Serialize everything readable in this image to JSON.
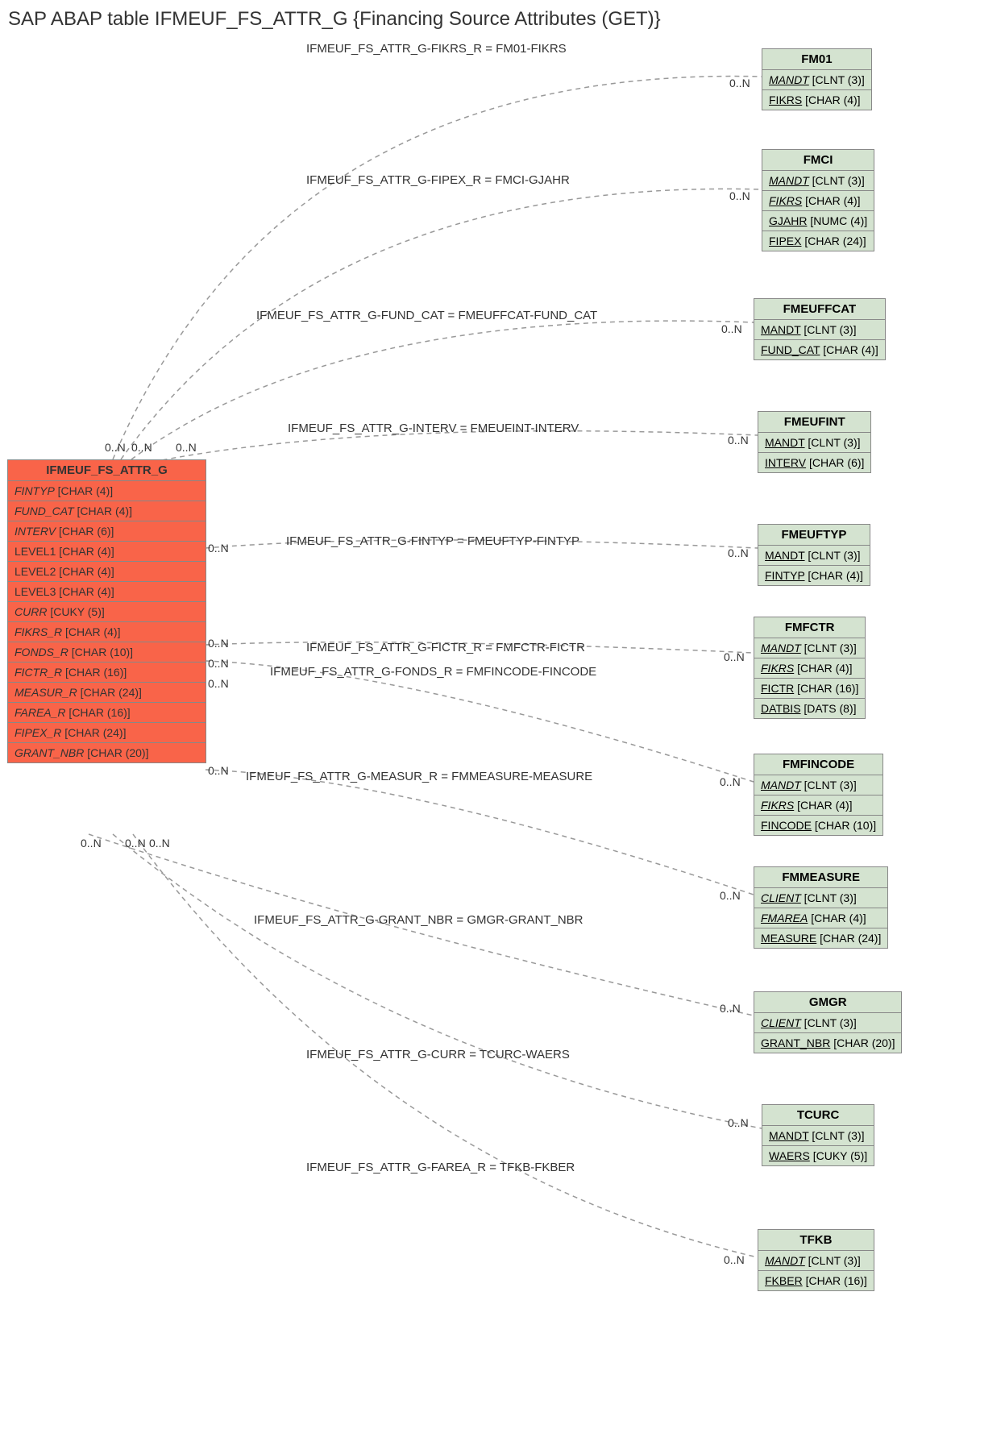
{
  "title": "SAP ABAP table IFMEUF_FS_ATTR_G {Financing Source Attributes (GET)}",
  "main": {
    "name": "IFMEUF_FS_ATTR_G",
    "fields": [
      {
        "name": "FINTYP",
        "type": "[CHAR (4)]",
        "italic": true
      },
      {
        "name": "FUND_CAT",
        "type": "[CHAR (4)]",
        "italic": true
      },
      {
        "name": "INTERV",
        "type": "[CHAR (6)]",
        "italic": true
      },
      {
        "name": "LEVEL1",
        "type": "[CHAR (4)]",
        "italic": false
      },
      {
        "name": "LEVEL2",
        "type": "[CHAR (4)]",
        "italic": false
      },
      {
        "name": "LEVEL3",
        "type": "[CHAR (4)]",
        "italic": false
      },
      {
        "name": "CURR",
        "type": "[CUKY (5)]",
        "italic": true
      },
      {
        "name": "FIKRS_R",
        "type": "[CHAR (4)]",
        "italic": true
      },
      {
        "name": "FONDS_R",
        "type": "[CHAR (10)]",
        "italic": true
      },
      {
        "name": "FICTR_R",
        "type": "[CHAR (16)]",
        "italic": true
      },
      {
        "name": "MEASUR_R",
        "type": "[CHAR (24)]",
        "italic": true
      },
      {
        "name": "FAREA_R",
        "type": "[CHAR (16)]",
        "italic": true
      },
      {
        "name": "FIPEX_R",
        "type": "[CHAR (24)]",
        "italic": true
      },
      {
        "name": "GRANT_NBR",
        "type": "[CHAR (20)]",
        "italic": true
      }
    ]
  },
  "refs": [
    {
      "name": "FM01",
      "fields": [
        {
          "name": "MANDT",
          "type": "[CLNT (3)]",
          "ul": true,
          "italic": true
        },
        {
          "name": "FIKRS",
          "type": "[CHAR (4)]",
          "ul": true,
          "italic": false
        }
      ]
    },
    {
      "name": "FMCI",
      "fields": [
        {
          "name": "MANDT",
          "type": "[CLNT (3)]",
          "ul": true,
          "italic": true
        },
        {
          "name": "FIKRS",
          "type": "[CHAR (4)]",
          "ul": true,
          "italic": true
        },
        {
          "name": "GJAHR",
          "type": "[NUMC (4)]",
          "ul": true,
          "italic": false
        },
        {
          "name": "FIPEX",
          "type": "[CHAR (24)]",
          "ul": true,
          "italic": false
        }
      ]
    },
    {
      "name": "FMEUFFCAT",
      "fields": [
        {
          "name": "MANDT",
          "type": "[CLNT (3)]",
          "ul": true,
          "italic": false
        },
        {
          "name": "FUND_CAT",
          "type": "[CHAR (4)]",
          "ul": true,
          "italic": false
        }
      ]
    },
    {
      "name": "FMEUFINT",
      "fields": [
        {
          "name": "MANDT",
          "type": "[CLNT (3)]",
          "ul": true,
          "italic": false
        },
        {
          "name": "INTERV",
          "type": "[CHAR (6)]",
          "ul": true,
          "italic": false
        }
      ]
    },
    {
      "name": "FMEUFTYP",
      "fields": [
        {
          "name": "MANDT",
          "type": "[CLNT (3)]",
          "ul": true,
          "italic": false
        },
        {
          "name": "FINTYP",
          "type": "[CHAR (4)]",
          "ul": true,
          "italic": false
        }
      ]
    },
    {
      "name": "FMFCTR",
      "fields": [
        {
          "name": "MANDT",
          "type": "[CLNT (3)]",
          "ul": true,
          "italic": true
        },
        {
          "name": "FIKRS",
          "type": "[CHAR (4)]",
          "ul": true,
          "italic": true
        },
        {
          "name": "FICTR",
          "type": "[CHAR (16)]",
          "ul": true,
          "italic": false
        },
        {
          "name": "DATBIS",
          "type": "[DATS (8)]",
          "ul": true,
          "italic": false
        }
      ]
    },
    {
      "name": "FMFINCODE",
      "fields": [
        {
          "name": "MANDT",
          "type": "[CLNT (3)]",
          "ul": true,
          "italic": true
        },
        {
          "name": "FIKRS",
          "type": "[CHAR (4)]",
          "ul": true,
          "italic": true
        },
        {
          "name": "FINCODE",
          "type": "[CHAR (10)]",
          "ul": true,
          "italic": false
        }
      ]
    },
    {
      "name": "FMMEASURE",
      "fields": [
        {
          "name": "CLIENT",
          "type": "[CLNT (3)]",
          "ul": true,
          "italic": true
        },
        {
          "name": "FMAREA",
          "type": "[CHAR (4)]",
          "ul": true,
          "italic": true
        },
        {
          "name": "MEASURE",
          "type": "[CHAR (24)]",
          "ul": true,
          "italic": false
        }
      ]
    },
    {
      "name": "GMGR",
      "fields": [
        {
          "name": "CLIENT",
          "type": "[CLNT (3)]",
          "ul": true,
          "italic": true
        },
        {
          "name": "GRANT_NBR",
          "type": "[CHAR (20)]",
          "ul": true,
          "italic": false
        }
      ]
    },
    {
      "name": "TCURC",
      "fields": [
        {
          "name": "MANDT",
          "type": "[CLNT (3)]",
          "ul": true,
          "italic": false
        },
        {
          "name": "WAERS",
          "type": "[CUKY (5)]",
          "ul": true,
          "italic": false
        }
      ]
    },
    {
      "name": "TFKB",
      "fields": [
        {
          "name": "MANDT",
          "type": "[CLNT (3)]",
          "ul": true,
          "italic": true
        },
        {
          "name": "FKBER",
          "type": "[CHAR (16)]",
          "ul": true,
          "italic": false
        }
      ]
    }
  ],
  "relations": [
    {
      "label": "IFMEUF_FS_ATTR_G-FIKRS_R = FM01-FIKRS"
    },
    {
      "label": "IFMEUF_FS_ATTR_G-FIPEX_R = FMCI-GJAHR"
    },
    {
      "label": "IFMEUF_FS_ATTR_G-FUND_CAT = FMEUFFCAT-FUND_CAT"
    },
    {
      "label": "IFMEUF_FS_ATTR_G-INTERV = FMEUFINT-INTERV"
    },
    {
      "label": "IFMEUF_FS_ATTR_G-FINTYP = FMEUFTYP-FINTYP"
    },
    {
      "label": "IFMEUF_FS_ATTR_G-FICTR_R = FMFCTR-FICTR"
    },
    {
      "label": "IFMEUF_FS_ATTR_G-FONDS_R = FMFINCODE-FINCODE"
    },
    {
      "label": "IFMEUF_FS_ATTR_G-MEASUR_R = FMMEASURE-MEASURE"
    },
    {
      "label": "IFMEUF_FS_ATTR_G-GRANT_NBR = GMGR-GRANT_NBR"
    },
    {
      "label": "IFMEUF_FS_ATTR_G-CURR = TCURC-WAERS"
    },
    {
      "label": "IFMEUF_FS_ATTR_G-FAREA_R = TFKB-FKBER"
    }
  ],
  "card_left": [
    "0..N",
    "0..N",
    "0..N",
    "0..N",
    "0..N",
    "0..N",
    "0..N",
    "0..N",
    "0..N",
    "0..N",
    "0..N"
  ],
  "card_right": [
    "0..N",
    "0..N",
    "0..N",
    "0..N",
    "0..N",
    "0..N",
    "0..N",
    "0..N",
    "0..N",
    "0..N",
    "0..N"
  ]
}
